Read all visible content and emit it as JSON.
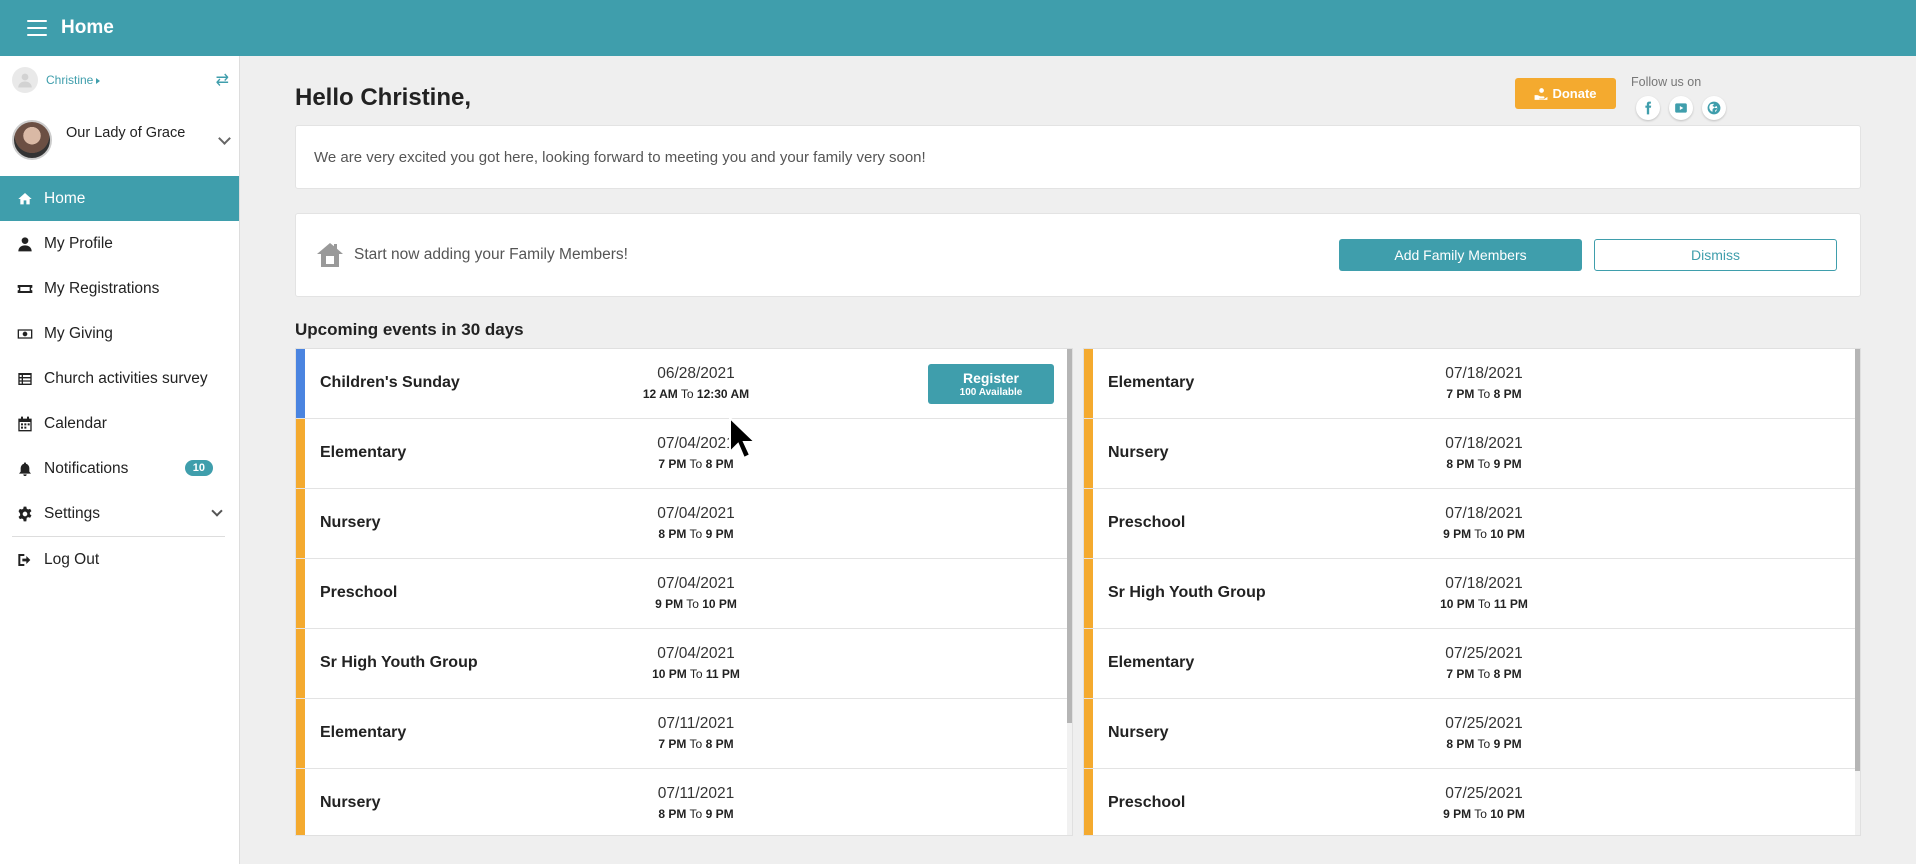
{
  "topbar": {
    "title": "Home"
  },
  "sidebar": {
    "user_name": "Christine",
    "parish_name": "Our Lady of Grace",
    "items": [
      {
        "label": "Home",
        "icon": "home-icon",
        "active": true
      },
      {
        "label": "My Profile",
        "icon": "user-icon"
      },
      {
        "label": "My Registrations",
        "icon": "ticket-icon"
      },
      {
        "label": "My Giving",
        "icon": "money-icon"
      },
      {
        "label": "Church activities survey",
        "icon": "list-icon"
      },
      {
        "label": "Calendar",
        "icon": "calendar-icon"
      },
      {
        "label": "Notifications",
        "icon": "bell-icon",
        "badge": "10"
      },
      {
        "label": "Settings",
        "icon": "gear-icon"
      },
      {
        "label": "Log Out",
        "icon": "logout-icon"
      }
    ]
  },
  "main": {
    "greeting": "Hello Christine,",
    "donate_label": "Donate",
    "follow_label": "Follow us on",
    "social": [
      "facebook-icon",
      "youtube-icon",
      "globe-icon"
    ],
    "welcome_message": "We are very excited you got here, looking forward to meeting you and your family very soon!",
    "family_prompt": "Start now adding your Family Members!",
    "add_family_label": "Add Family Members",
    "dismiss_label": "Dismiss",
    "upcoming_title": "Upcoming events in 30 days",
    "time_separator": "To",
    "register_label": "Register",
    "colors": {
      "accent": "#3f9eac",
      "donate": "#f4aa2f",
      "stripe_blue": "#4a84e0",
      "stripe_orange": "#f4aa2f"
    },
    "events_left": [
      {
        "name": "Children's Sunday",
        "date": "06/28/2021",
        "start": "12 AM",
        "end": "12:30 AM",
        "stripe": "blue",
        "register": true,
        "available": "100 Available"
      },
      {
        "name": "Elementary",
        "date": "07/04/2021",
        "start": "7 PM",
        "end": "8 PM",
        "stripe": "orange"
      },
      {
        "name": "Nursery",
        "date": "07/04/2021",
        "start": "8 PM",
        "end": "9 PM",
        "stripe": "orange"
      },
      {
        "name": "Preschool",
        "date": "07/04/2021",
        "start": "9 PM",
        "end": "10 PM",
        "stripe": "orange"
      },
      {
        "name": "Sr High Youth Group",
        "date": "07/04/2021",
        "start": "10 PM",
        "end": "11 PM",
        "stripe": "orange"
      },
      {
        "name": "Elementary",
        "date": "07/11/2021",
        "start": "7 PM",
        "end": "8 PM",
        "stripe": "orange"
      },
      {
        "name": "Nursery",
        "date": "07/11/2021",
        "start": "8 PM",
        "end": "9 PM",
        "stripe": "orange"
      }
    ],
    "events_right": [
      {
        "name": "Elementary",
        "date": "07/18/2021",
        "start": "7 PM",
        "end": "8 PM",
        "stripe": "orange"
      },
      {
        "name": "Nursery",
        "date": "07/18/2021",
        "start": "8 PM",
        "end": "9 PM",
        "stripe": "orange"
      },
      {
        "name": "Preschool",
        "date": "07/18/2021",
        "start": "9 PM",
        "end": "10 PM",
        "stripe": "orange"
      },
      {
        "name": "Sr High Youth Group",
        "date": "07/18/2021",
        "start": "10 PM",
        "end": "11 PM",
        "stripe": "orange"
      },
      {
        "name": "Elementary",
        "date": "07/25/2021",
        "start": "7 PM",
        "end": "8 PM",
        "stripe": "orange"
      },
      {
        "name": "Nursery",
        "date": "07/25/2021",
        "start": "8 PM",
        "end": "9 PM",
        "stripe": "orange"
      },
      {
        "name": "Preschool",
        "date": "07/25/2021",
        "start": "9 PM",
        "end": "10 PM",
        "stripe": "orange"
      }
    ]
  }
}
